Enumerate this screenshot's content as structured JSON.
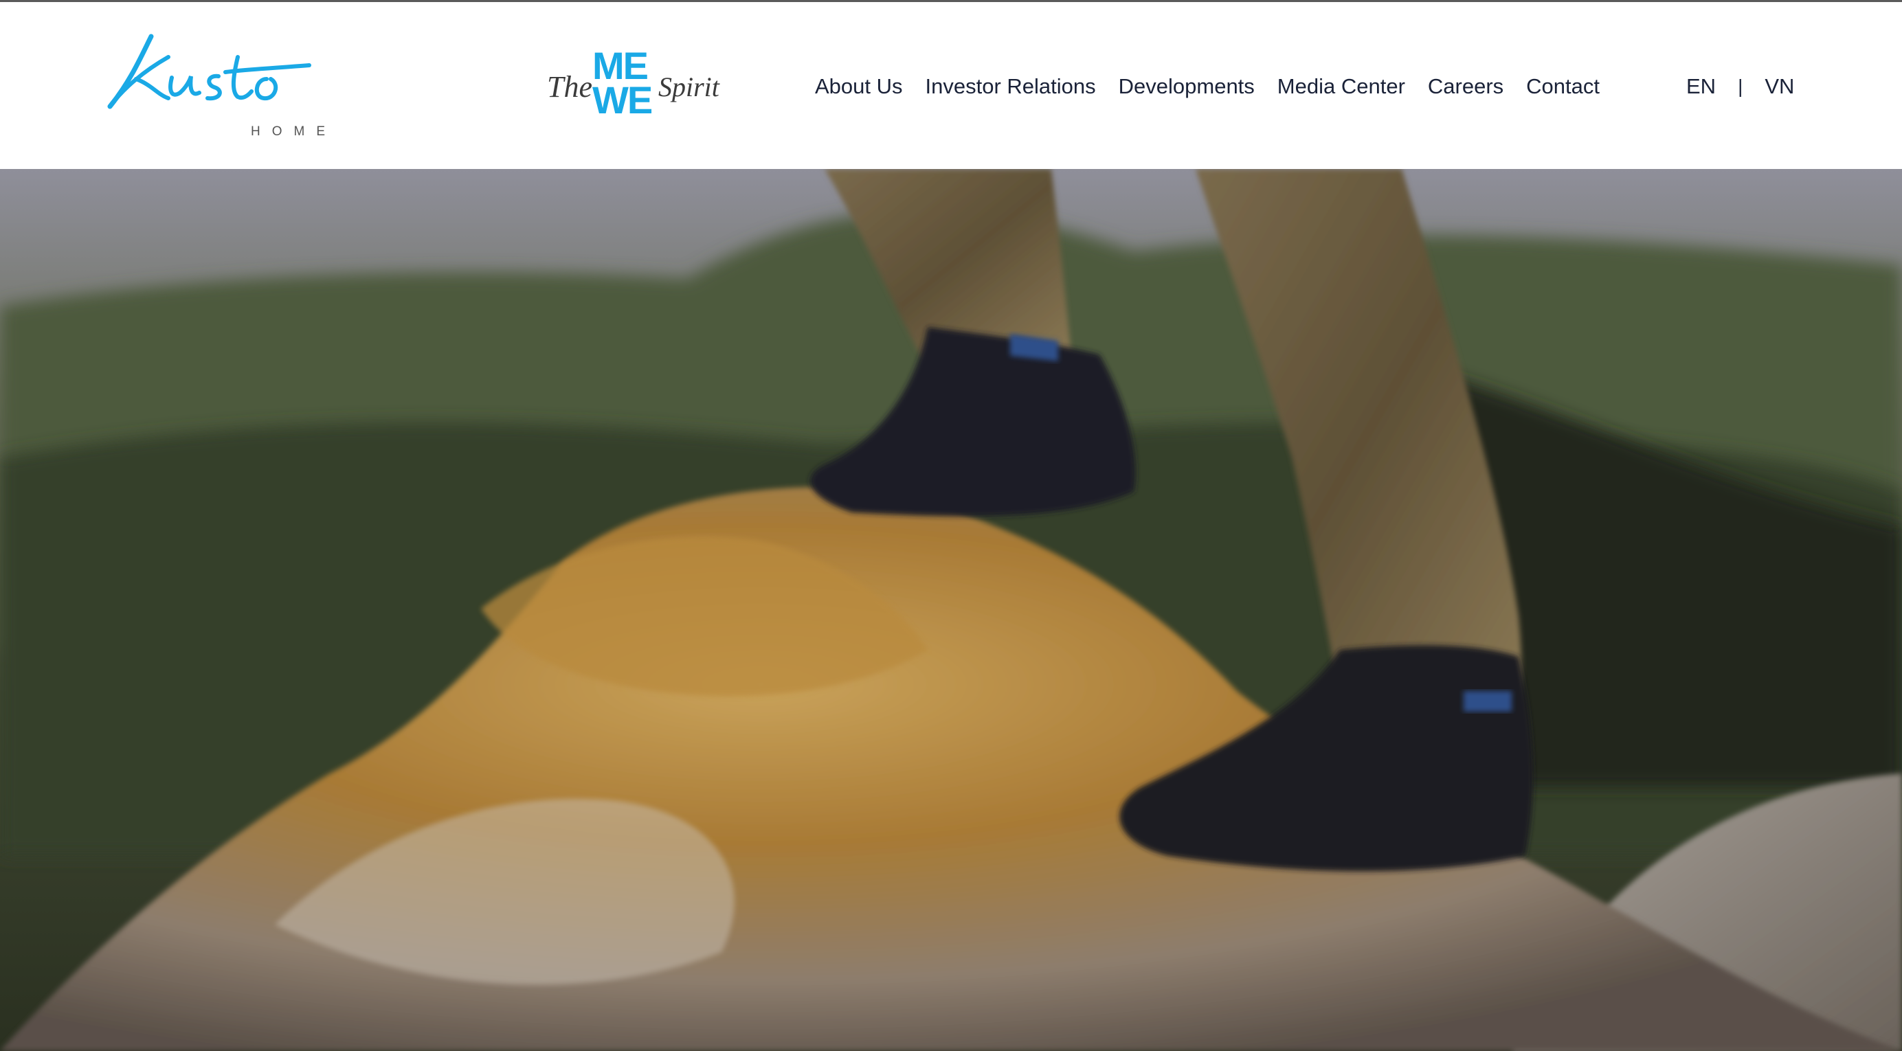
{
  "brand": {
    "logo_text": "Kusto",
    "logo_sub": "HOME",
    "accent_color": "#1aa9e6"
  },
  "campaign": {
    "the": "The",
    "me": "ME",
    "we": "WE",
    "spirit": "Spirit"
  },
  "nav": {
    "items": [
      {
        "label": "About Us"
      },
      {
        "label": "Investor Relations"
      },
      {
        "label": "Developments"
      },
      {
        "label": "Media Center"
      },
      {
        "label": "Careers"
      },
      {
        "label": "Contact"
      }
    ]
  },
  "lang": {
    "en": "EN",
    "separator": "|",
    "vn": "VN"
  },
  "hero": {
    "image": "hiker-boots-on-mossy-rock"
  }
}
